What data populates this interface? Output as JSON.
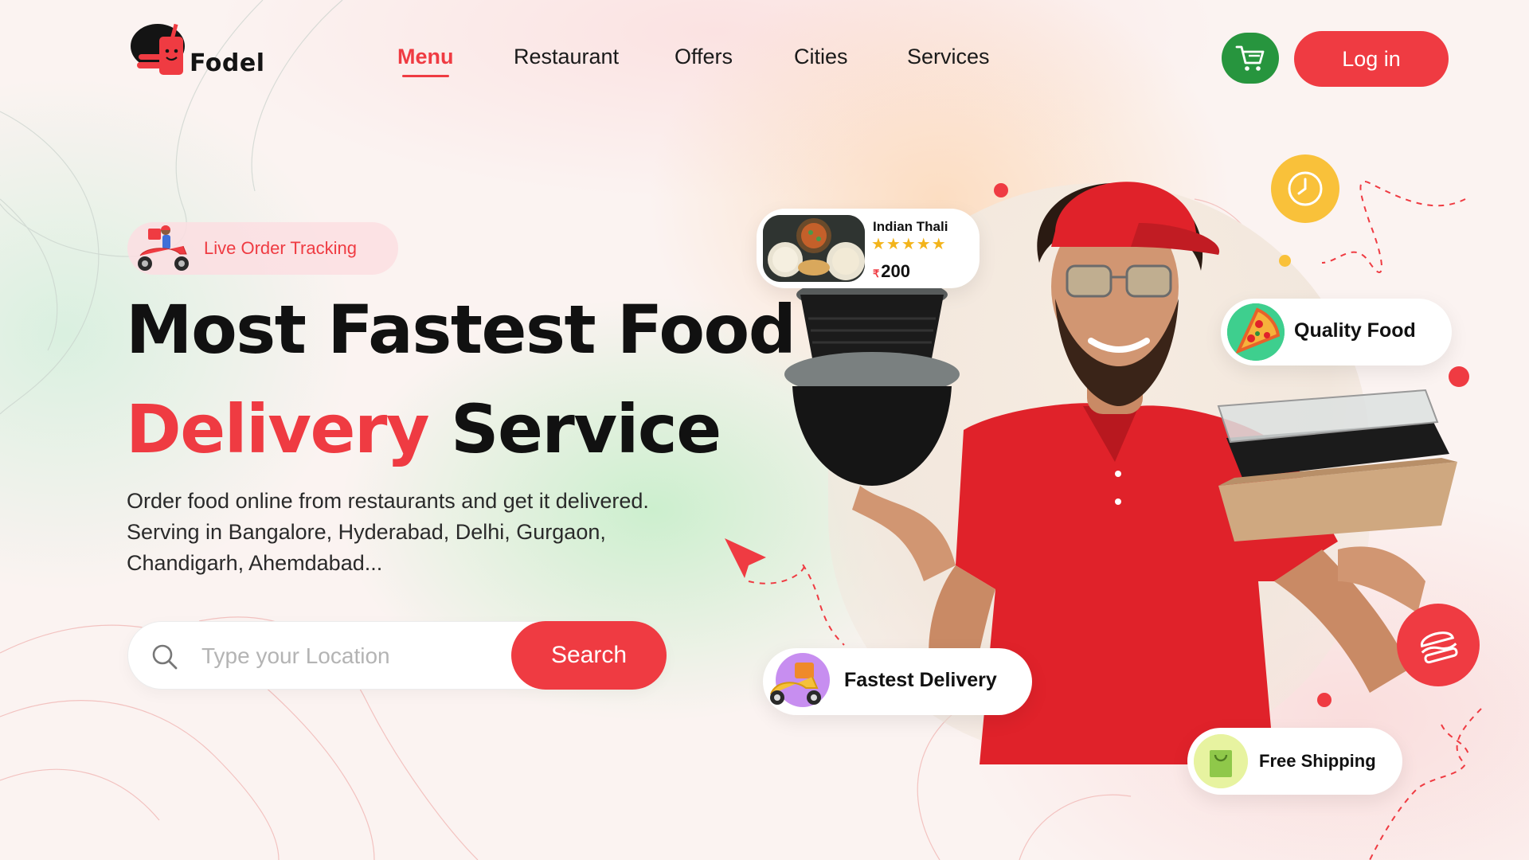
{
  "brand": {
    "name": "Fodel",
    "accent": "#ef3b42",
    "green": "#27953e",
    "yellow": "#f9c13a"
  },
  "nav": {
    "items": [
      {
        "label": "Menu",
        "active": true
      },
      {
        "label": "Restaurant",
        "active": false
      },
      {
        "label": "Offers",
        "active": false
      },
      {
        "label": "Cities",
        "active": false
      },
      {
        "label": "Services",
        "active": false
      }
    ],
    "cart_icon": "cart-icon",
    "login_label": "Log in"
  },
  "hero": {
    "badge_label": "Live Order Tracking",
    "title_line1": "Most Fastest Food",
    "title_highlight": "Delivery",
    "title_rest": "Service",
    "description": "Order food online from restaurants and get it delivered. Serving in Bangalore, Hyderabad, Delhi, Gurgaon, Chandigarh, Ahemdabad...",
    "search": {
      "placeholder": "Type your Location",
      "value": "",
      "button_label": "Search"
    }
  },
  "cards": {
    "thali": {
      "name": "Indian Thali",
      "rating": 4.5,
      "stars": "★★★★★",
      "currency": "₹",
      "price": "200"
    },
    "quality": {
      "label": "Quality Food",
      "icon": "pizza-icon"
    },
    "fastest": {
      "label": "Fastest Delivery",
      "icon": "scooter-icon"
    },
    "shipping": {
      "label": "Free Shipping",
      "icon": "shopping-bag-icon"
    }
  },
  "badges": {
    "clock_icon": "clock-icon",
    "burger_icon": "burger-icon"
  }
}
